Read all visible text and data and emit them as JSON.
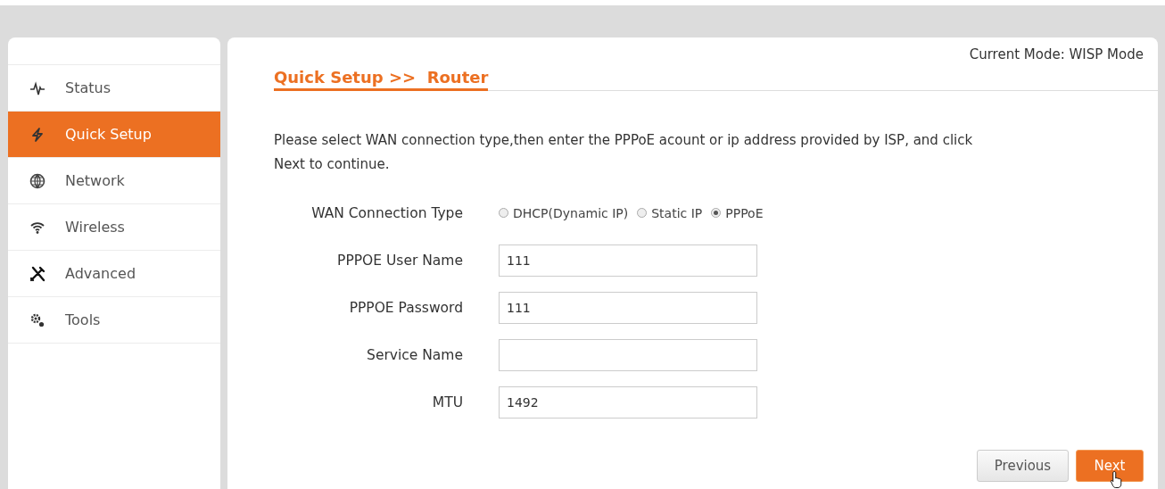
{
  "sidebar": {
    "items": [
      {
        "label": "Status",
        "selected": false
      },
      {
        "label": "Quick Setup",
        "selected": true
      },
      {
        "label": "Network",
        "selected": false
      },
      {
        "label": "Wireless",
        "selected": false
      },
      {
        "label": "Advanced",
        "selected": false
      },
      {
        "label": "Tools",
        "selected": false
      }
    ]
  },
  "main": {
    "mode": "Current Mode: WISP Mode",
    "heading": "Quick Setup >>  Router",
    "instructions": "Please select WAN connection type,then enter the PPPoE acount or ip address provided by ISP, and click Next to continue.",
    "form": [
      {
        "kind": "radio",
        "label": "WAN Connection Type",
        "options": [
          {
            "label": "DHCP(Dynamic IP)",
            "selected": false
          },
          {
            "label": "Static IP",
            "selected": false
          },
          {
            "label": "PPPoE",
            "selected": true
          }
        ]
      },
      {
        "kind": "text",
        "label": "PPPOE User Name",
        "value": "111"
      },
      {
        "kind": "text",
        "label": "PPPOE Password",
        "value": "111"
      },
      {
        "kind": "text",
        "label": "Service Name"
      },
      {
        "kind": "text",
        "label": "MTU",
        "value": "1492"
      }
    ],
    "buttons": [
      {
        "label": "Previous",
        "kind": "secondary"
      },
      {
        "label": "Next",
        "kind": "primary"
      }
    ]
  }
}
